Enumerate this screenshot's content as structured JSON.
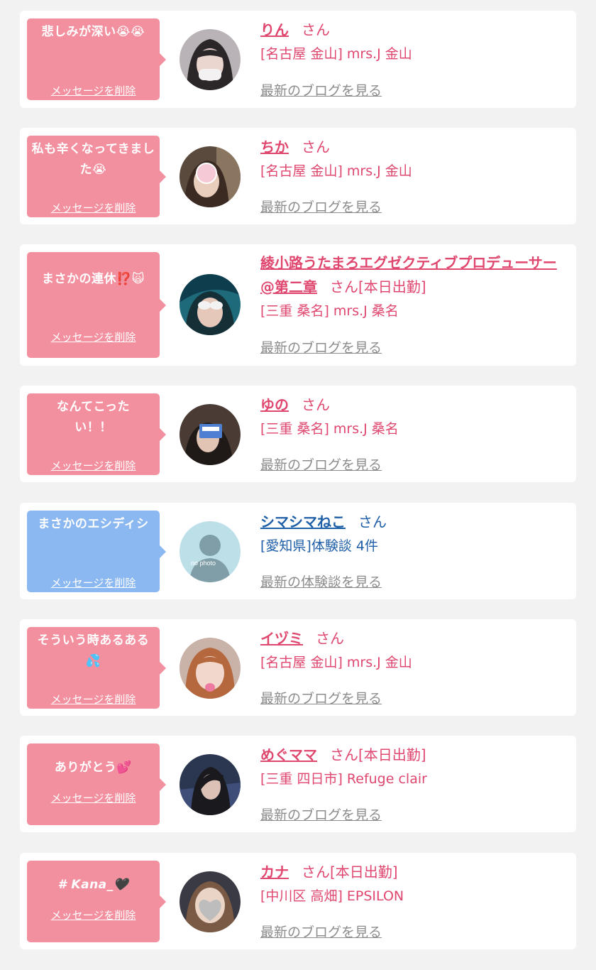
{
  "cards": [
    {
      "bubble_text": "悲しみが深い😭😭",
      "delete_label": "メッセージを削除",
      "name": "りん",
      "suffix": "さん",
      "shop": "[名古屋 金山] mrs.J 金山",
      "link": "最新のブログを見る"
    },
    {
      "bubble_text": "私も辛くなってきました😭",
      "delete_label": "メッセージを削除",
      "name": "ちか",
      "suffix": "さん",
      "shop": "[名古屋 金山] mrs.J 金山",
      "link": "最新のブログを見る"
    },
    {
      "bubble_text": "まさかの連休⁉️🙀",
      "delete_label": "メッセージを削除",
      "name": "綾小路うたまろエグゼクティブプロデューサー@第二章",
      "suffix": "さん[本日出勤]",
      "shop": "[三重 桑名] mrs.J 桑名",
      "link": "最新のブログを見る"
    },
    {
      "bubble_text": "なんてこったい！！",
      "delete_label": "メッセージを削除",
      "name": "ゆの",
      "suffix": "さん",
      "shop": "[三重 桑名] mrs.J 桑名",
      "link": "最新のブログを見る"
    },
    {
      "bubble_text": "まさかのエシディシ",
      "delete_label": "メッセージを削除",
      "name": "シマシマねこ",
      "suffix": "さん",
      "shop": "[愛知県]体験談 4件",
      "link": "最新の体験談を見る",
      "avatar_text": "no photo"
    },
    {
      "bubble_text": "そういう時あるある💦",
      "delete_label": "メッセージを削除",
      "name": "イヅミ",
      "suffix": "さん",
      "shop": "[名古屋 金山] mrs.J 金山",
      "link": "最新のブログを見る"
    },
    {
      "bubble_text": "ありがとう💕",
      "delete_label": "メッセージを削除",
      "name": "めぐママ",
      "suffix": "さん[本日出勤]",
      "shop": "[三重 四日市] Refuge clair",
      "link": "最新のブログを見る"
    },
    {
      "bubble_text": "# Kana_🖤",
      "delete_label": "メッセージを削除",
      "name": "カナ",
      "suffix": "さん[本日出勤]",
      "shop": "[中川区 高畑] EPSILON",
      "link": "最新のブログを見る"
    }
  ],
  "colors": {
    "page_bg": "#f2f2f2",
    "bubble_pink": "#f3909f",
    "bubble_blue": "#8bb8f0",
    "name_pink": "#e0476f",
    "name_blue": "#1f5fa8",
    "link_gray": "#8c8c8c"
  }
}
